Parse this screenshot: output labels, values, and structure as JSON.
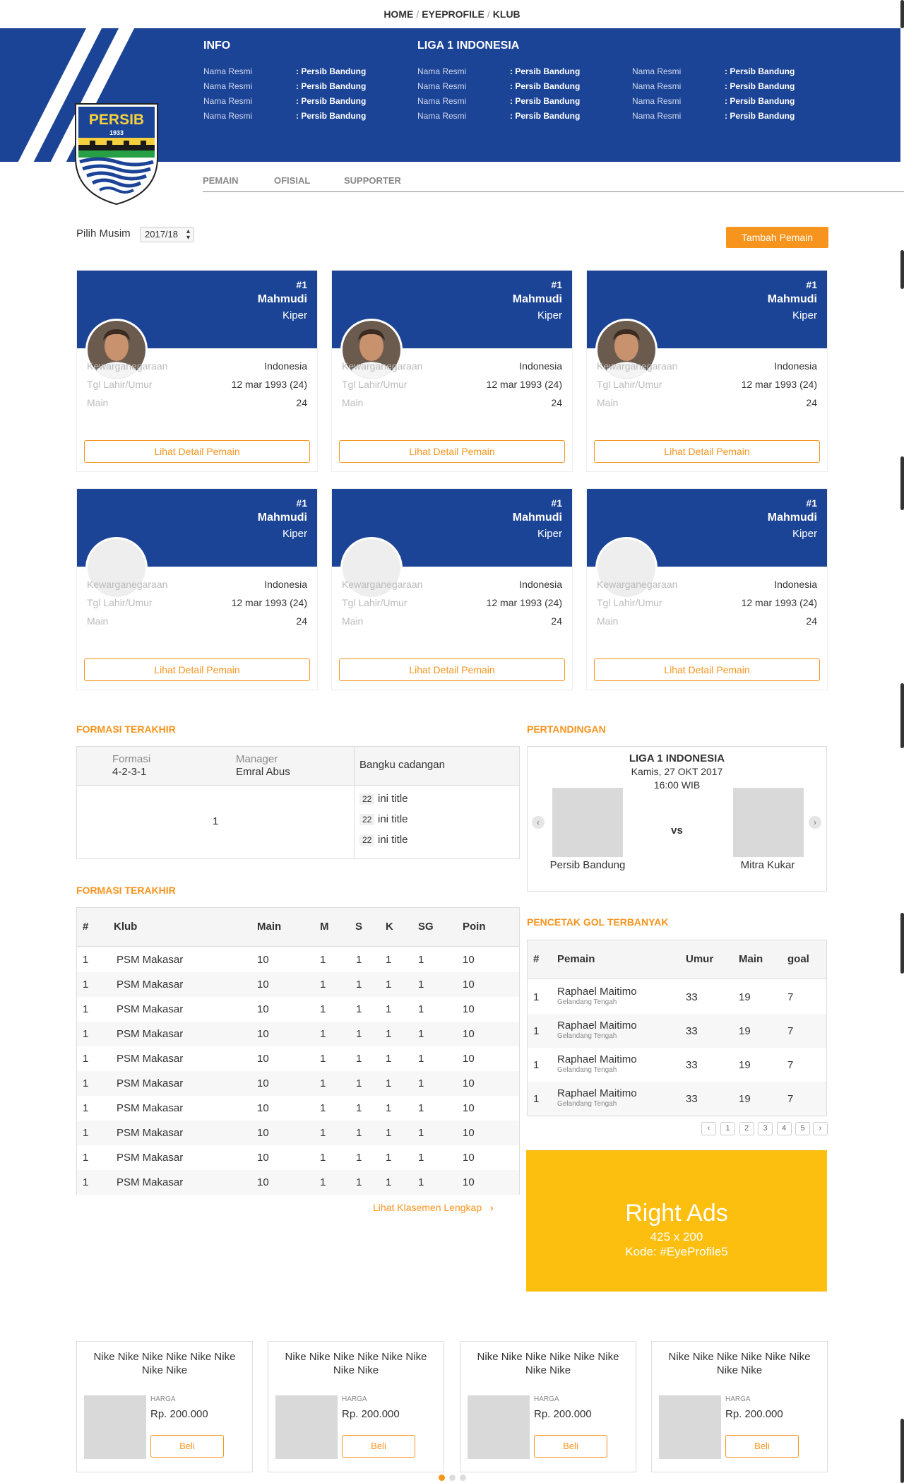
{
  "breadcrumb": [
    "HOME",
    "EYEPROFILE",
    "KLUB"
  ],
  "hero": {
    "info_title": "INFO",
    "league_title": "LIGA 1 INDONESIA",
    "logo_text": "PERSIB",
    "logo_year": "1933",
    "columns": [
      [
        {
          "label": "Nama Resmi",
          "value": ": Persib Bandung"
        },
        {
          "label": "Nama Resmi",
          "value": ": Persib Bandung"
        },
        {
          "label": "Nama Resmi",
          "value": ": Persib Bandung"
        },
        {
          "label": "Nama Resmi",
          "value": ": Persib Bandung"
        }
      ],
      [
        {
          "label": "Nama Resmi",
          "value": ": Persib Bandung"
        },
        {
          "label": "Nama Resmi",
          "value": ": Persib Bandung"
        },
        {
          "label": "Nama Resmi",
          "value": ": Persib Bandung"
        },
        {
          "label": "Nama Resmi",
          "value": ": Persib Bandung"
        }
      ],
      [
        {
          "label": "Nama Resmi",
          "value": ": Persib Bandung"
        },
        {
          "label": "Nama Resmi",
          "value": ": Persib Bandung"
        },
        {
          "label": "Nama Resmi",
          "value": ": Persib Bandung"
        },
        {
          "label": "Nama Resmi",
          "value": ": Persib Bandung"
        }
      ]
    ]
  },
  "tabs": [
    "PEMAIN",
    "OFISIAL",
    "SUPPORTER"
  ],
  "season": {
    "label": "Pilih Musim",
    "value": "2017/18"
  },
  "add_player_button": "Tambah Pemain",
  "players": [
    {
      "number": "#1",
      "name": "Mahmudi",
      "position": "Kiper",
      "photo": true,
      "nationality_label": "Kewarganegaraan",
      "nationality": "Indonesia",
      "dob_label": "Tgl Lahir/Umur",
      "dob": "12 mar 1993 (24)",
      "played_label": "Main",
      "played": "24",
      "detail": "Lihat Detail Pemain"
    },
    {
      "number": "#1",
      "name": "Mahmudi",
      "position": "Kiper",
      "photo": true,
      "nationality_label": "Kewarganegaraan",
      "nationality": "Indonesia",
      "dob_label": "Tgl Lahir/Umur",
      "dob": "12 mar 1993 (24)",
      "played_label": "Main",
      "played": "24",
      "detail": "Lihat Detail Pemain"
    },
    {
      "number": "#1",
      "name": "Mahmudi",
      "position": "Kiper",
      "photo": true,
      "nationality_label": "Kewarganegaraan",
      "nationality": "Indonesia",
      "dob_label": "Tgl Lahir/Umur",
      "dob": "12 mar 1993 (24)",
      "played_label": "Main",
      "played": "24",
      "detail": "Lihat Detail Pemain"
    },
    {
      "number": "#1",
      "name": "Mahmudi",
      "position": "Kiper",
      "photo": false,
      "nationality_label": "Kewarganegaraan",
      "nationality": "Indonesia",
      "dob_label": "Tgl Lahir/Umur",
      "dob": "12 mar 1993 (24)",
      "played_label": "Main",
      "played": "24",
      "detail": "Lihat Detail Pemain"
    },
    {
      "number": "#1",
      "name": "Mahmudi",
      "position": "Kiper",
      "photo": false,
      "nationality_label": "Kewarganegaraan",
      "nationality": "Indonesia",
      "dob_label": "Tgl Lahir/Umur",
      "dob": "12 mar 1993 (24)",
      "played_label": "Main",
      "played": "24",
      "detail": "Lihat Detail Pemain"
    },
    {
      "number": "#1",
      "name": "Mahmudi",
      "position": "Kiper",
      "photo": false,
      "nationality_label": "Kewarganegaraan",
      "nationality": "Indonesia",
      "dob_label": "Tgl Lahir/Umur",
      "dob": "12 mar 1993 (24)",
      "played_label": "Main",
      "played": "24",
      "detail": "Lihat Detail Pemain"
    }
  ],
  "formation": {
    "section_title": "FORMASI TERAKHIR",
    "formasi_label": "Formasi",
    "formasi_value": "4-2-3-1",
    "manager_label": "Manager",
    "manager_value": "Emral Abus",
    "bench_label": "Bangku cadangan",
    "pitch_value": "1",
    "bench": [
      {
        "num": "22",
        "title": "ini title"
      },
      {
        "num": "22",
        "title": "ini title"
      },
      {
        "num": "22",
        "title": "ini title"
      }
    ]
  },
  "match": {
    "section_title": "PERTANDINGAN",
    "league": "LIGA 1 INDONESIA",
    "date": "Kamis, 27 OKT 2017",
    "time": "16:00 WIB",
    "vs": "vs",
    "home": "Persib Bandung",
    "away": "Mitra Kukar",
    "prev_icon": "chevron-left",
    "next_icon": "chevron-right"
  },
  "standings": {
    "section_title": "FORMASI TERAKHIR",
    "headers": [
      "#",
      "Klub",
      "Main",
      "M",
      "S",
      "K",
      "SG",
      "Poin"
    ],
    "rows": [
      [
        "1",
        "PSM Makasar",
        "10",
        "1",
        "1",
        "1",
        "1",
        "10"
      ],
      [
        "1",
        "PSM Makasar",
        "10",
        "1",
        "1",
        "1",
        "1",
        "10"
      ],
      [
        "1",
        "PSM Makasar",
        "10",
        "1",
        "1",
        "1",
        "1",
        "10"
      ],
      [
        "1",
        "PSM Makasar",
        "10",
        "1",
        "1",
        "1",
        "1",
        "10"
      ],
      [
        "1",
        "PSM Makasar",
        "10",
        "1",
        "1",
        "1",
        "1",
        "10"
      ],
      [
        "1",
        "PSM Makasar",
        "10",
        "1",
        "1",
        "1",
        "1",
        "10"
      ],
      [
        "1",
        "PSM Makasar",
        "10",
        "1",
        "1",
        "1",
        "1",
        "10"
      ],
      [
        "1",
        "PSM Makasar",
        "10",
        "1",
        "1",
        "1",
        "1",
        "10"
      ],
      [
        "1",
        "PSM Makasar",
        "10",
        "1",
        "1",
        "1",
        "1",
        "10"
      ],
      [
        "1",
        "PSM Makasar",
        "10",
        "1",
        "1",
        "1",
        "1",
        "10"
      ]
    ],
    "full_link": "Lihat Klasemen Lengkap"
  },
  "scorers": {
    "section_title": "PENCETAK GOL TERBANYAK",
    "headers": [
      "#",
      "Pemain",
      "Umur",
      "Main",
      "goal"
    ],
    "rows": [
      {
        "rank": "1",
        "name": "Raphael Maitimo",
        "role": "Gelandang Tengah",
        "age": "33",
        "played": "19",
        "goals": "7"
      },
      {
        "rank": "1",
        "name": "Raphael Maitimo",
        "role": "Gelandang Tengah",
        "age": "33",
        "played": "19",
        "goals": "7"
      },
      {
        "rank": "1",
        "name": "Raphael Maitimo",
        "role": "Gelandang Tengah",
        "age": "33",
        "played": "19",
        "goals": "7"
      },
      {
        "rank": "1",
        "name": "Raphael Maitimo",
        "role": "Gelandang Tengah",
        "age": "33",
        "played": "19",
        "goals": "7"
      }
    ],
    "pages": [
      "1",
      "2",
      "3",
      "4",
      "5"
    ]
  },
  "ads": {
    "title": "Right Ads",
    "size": "425 x 200",
    "code": "Kode: #EyeProfile5",
    "color": "#fdbf0f"
  },
  "products": [
    {
      "title": "Nike Nike Nike Nike Nike Nike Nike Nike",
      "price_label": "HARGA",
      "price": "Rp. 200.000",
      "buy": "Beli"
    },
    {
      "title": "Nike Nike Nike Nike Nike Nike Nike Nike",
      "price_label": "HARGA",
      "price": "Rp. 200.000",
      "buy": "Beli"
    },
    {
      "title": "Nike Nike Nike Nike Nike Nike Nike Nike",
      "price_label": "HARGA",
      "price": "Rp. 200.000",
      "buy": "Beli"
    },
    {
      "title": "Nike Nike Nike Nike Nike Nike Nike Nike",
      "price_label": "HARGA",
      "price": "Rp. 200.000",
      "buy": "Beli"
    }
  ],
  "colors": {
    "primary": "#1c4496",
    "accent": "#f7941d"
  }
}
